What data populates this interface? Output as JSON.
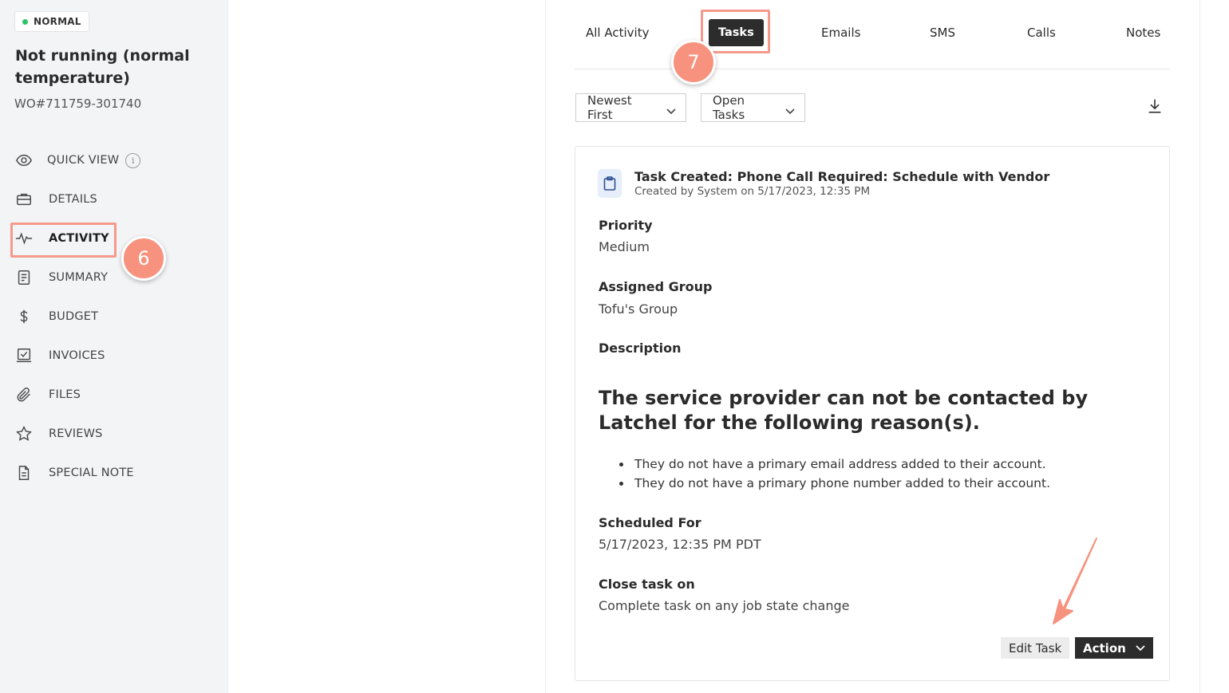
{
  "sidebar": {
    "status": "NORMAL",
    "job_title": "Not running (normal temperature)",
    "wo_number": "WO#711759-301740",
    "items": [
      {
        "label": "QUICK VIEW",
        "icon": "eye-icon"
      },
      {
        "label": "DETAILS",
        "icon": "briefcase-icon"
      },
      {
        "label": "ACTIVITY",
        "icon": "activity-pulse-icon"
      },
      {
        "label": "SUMMARY",
        "icon": "summary-document-icon"
      },
      {
        "label": "BUDGET",
        "icon": "dollar-icon"
      },
      {
        "label": "INVOICES",
        "icon": "invoice-check-icon"
      },
      {
        "label": "FILES",
        "icon": "paperclip-icon"
      },
      {
        "label": "REVIEWS",
        "icon": "star-icon"
      },
      {
        "label": "SPECIAL NOTE",
        "icon": "note-document-icon"
      }
    ],
    "info_glyph": "i"
  },
  "annotations": {
    "step6": "6",
    "step7": "7",
    "highlight_color": "#f59a8a",
    "badge_color": "#f6927d"
  },
  "activity": {
    "tabs": [
      "All Activity",
      "Tasks",
      "Emails",
      "SMS",
      "Calls",
      "Notes"
    ],
    "active_tab": "Tasks",
    "sort_filter": "Newest First",
    "status_filter": "Open Tasks",
    "task": {
      "title": "Task Created: Phone Call Required: Schedule with Vendor",
      "subtitle": "Created by System on 5/17/2023, 12:35 PM",
      "priority_label": "Priority",
      "priority_value": "Medium",
      "group_label": "Assigned Group",
      "group_value": "Tofu's Group",
      "description_label": "Description",
      "description_heading": "The service provider can not be contacted by Latchel for the following reason(s).",
      "description_items": [
        "They do not have a primary email address added to their account.",
        "They do not have a primary phone number added to their account."
      ],
      "scheduled_label": "Scheduled For",
      "scheduled_value": "5/17/2023, 12:35 PM PDT",
      "close_label": "Close task on",
      "close_value": "Complete task on any job state change",
      "edit_button": "Edit Task",
      "action_button": "Action"
    }
  }
}
